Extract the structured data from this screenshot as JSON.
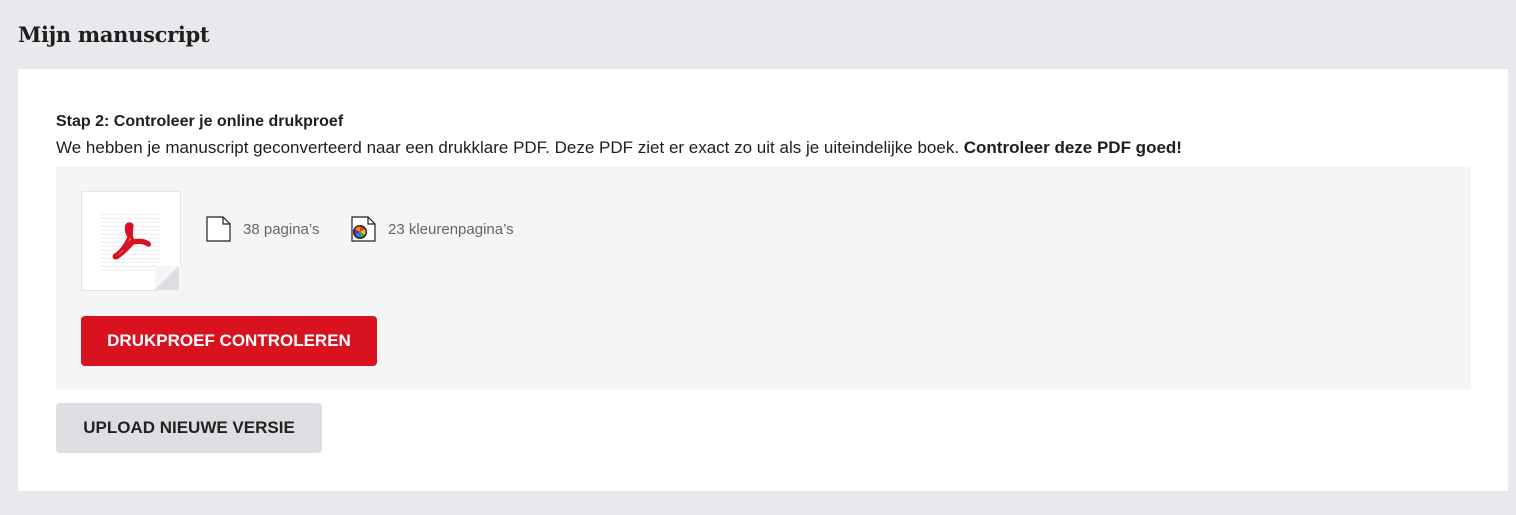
{
  "page": {
    "title": "Mijn manuscript"
  },
  "step": {
    "title": "Stap 2: Controleer je online drukproef",
    "description": "We hebben je manuscript geconverteerd naar een drukklare PDF. Deze PDF ziet er exact zo uit als je uiteindelijke boek. ",
    "description_emphasis": "Controleer deze PDF goed!"
  },
  "proof": {
    "thumbnail_icon": "pdf-document-icon",
    "pages_icon": "page-icon",
    "pages_label": "38 pagina’s",
    "color_pages_icon": "color-page-icon",
    "color_pages_label": "23 kleurenpagina’s",
    "check_button": "DRUKPROEF CONTROLEREN"
  },
  "actions": {
    "upload_button": "UPLOAD NIEUWE VERSIE"
  },
  "colors": {
    "background": "#e8e9ec",
    "card": "#ffffff",
    "panel": "#f4f5f7",
    "primary": "#d8121f",
    "secondary": "#dcdee1",
    "acrobat_red": "#d8121f"
  }
}
